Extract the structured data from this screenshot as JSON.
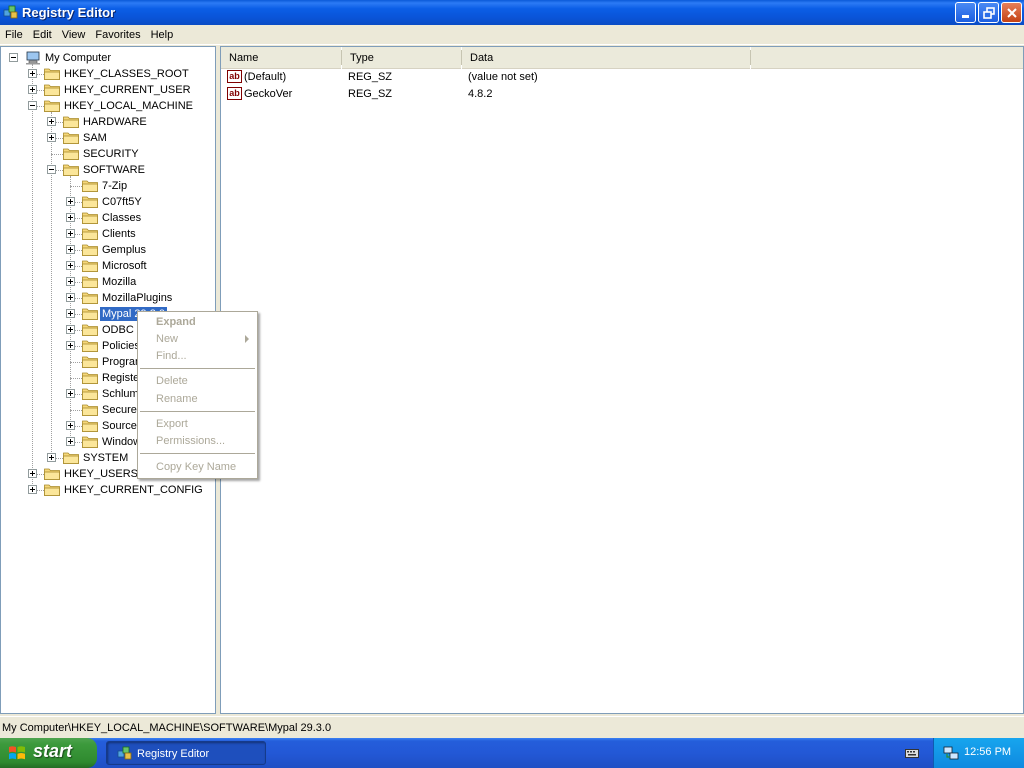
{
  "window": {
    "title": "Registry Editor"
  },
  "menu": [
    "File",
    "Edit",
    "View",
    "Favorites",
    "Help"
  ],
  "tree": {
    "nodes": [
      {
        "label": "My Computer",
        "toggle": "minus"
      },
      {
        "label": "HKEY_CLASSES_ROOT",
        "toggle": "plus"
      },
      {
        "label": "HKEY_CURRENT_USER",
        "toggle": "plus"
      },
      {
        "label": "HKEY_LOCAL_MACHINE",
        "toggle": "minus"
      },
      {
        "label": "HARDWARE",
        "toggle": "plus"
      },
      {
        "label": "SAM",
        "toggle": "plus"
      },
      {
        "label": "SECURITY",
        "toggle": "none"
      },
      {
        "label": "SOFTWARE",
        "toggle": "minus"
      },
      {
        "label": "7-Zip",
        "toggle": "none"
      },
      {
        "label": "C07ft5Y",
        "toggle": "plus"
      },
      {
        "label": "Classes",
        "toggle": "plus"
      },
      {
        "label": "Clients",
        "toggle": "plus"
      },
      {
        "label": "Gemplus",
        "toggle": "plus"
      },
      {
        "label": "Microsoft",
        "toggle": "plus"
      },
      {
        "label": "Mozilla",
        "toggle": "plus"
      },
      {
        "label": "MozillaPlugins",
        "toggle": "plus"
      },
      {
        "label": "Mypal 29.3.0",
        "toggle": "plus",
        "selected": true
      },
      {
        "label": "ODBC",
        "toggle": "plus"
      },
      {
        "label": "Policies",
        "toggle": "plus"
      },
      {
        "label": "Program Groups",
        "toggle": "none"
      },
      {
        "label": "RegisteredApplications",
        "toggle": "none"
      },
      {
        "label": "Schlumberger",
        "toggle": "plus"
      },
      {
        "label": "Secure",
        "toggle": "none"
      },
      {
        "label": "SourceCodeControlProvider",
        "toggle": "plus"
      },
      {
        "label": "Windows 3.1 Migration Status",
        "toggle": "plus"
      },
      {
        "label": "SYSTEM",
        "toggle": "plus"
      },
      {
        "label": "HKEY_USERS",
        "toggle": "plus"
      },
      {
        "label": "HKEY_CURRENT_CONFIG",
        "toggle": "plus"
      }
    ]
  },
  "list": {
    "columns": [
      "Name",
      "Type",
      "Data"
    ],
    "rows": [
      {
        "name": "(Default)",
        "type": "REG_SZ",
        "data": "(value not set)",
        "icon": "string-value-icon"
      },
      {
        "name": "GeckoVer",
        "type": "REG_SZ",
        "data": "4.8.2",
        "icon": "string-value-icon"
      }
    ]
  },
  "context_menu": {
    "items": [
      {
        "label": "Expand",
        "bold": true
      },
      {
        "label": "New",
        "submenu": true
      },
      {
        "label": "Find..."
      },
      {
        "label": "Delete"
      },
      {
        "label": "Rename"
      },
      {
        "label": "Export"
      },
      {
        "label": "Permissions..."
      },
      {
        "label": "Copy Key Name"
      }
    ]
  },
  "status": {
    "path": "My Computer\\HKEY_LOCAL_MACHINE\\SOFTWARE\\Mypal 29.3.0"
  },
  "taskbar": {
    "start_label": "start",
    "task_label": "Registry Editor",
    "clock": "12:56 PM"
  },
  "colors": {
    "selection": "#316ac5",
    "titlebar": "#0a54d8",
    "taskbar": "#245edb",
    "start": "#3c9a3c",
    "tray": "#0f8ae0"
  }
}
